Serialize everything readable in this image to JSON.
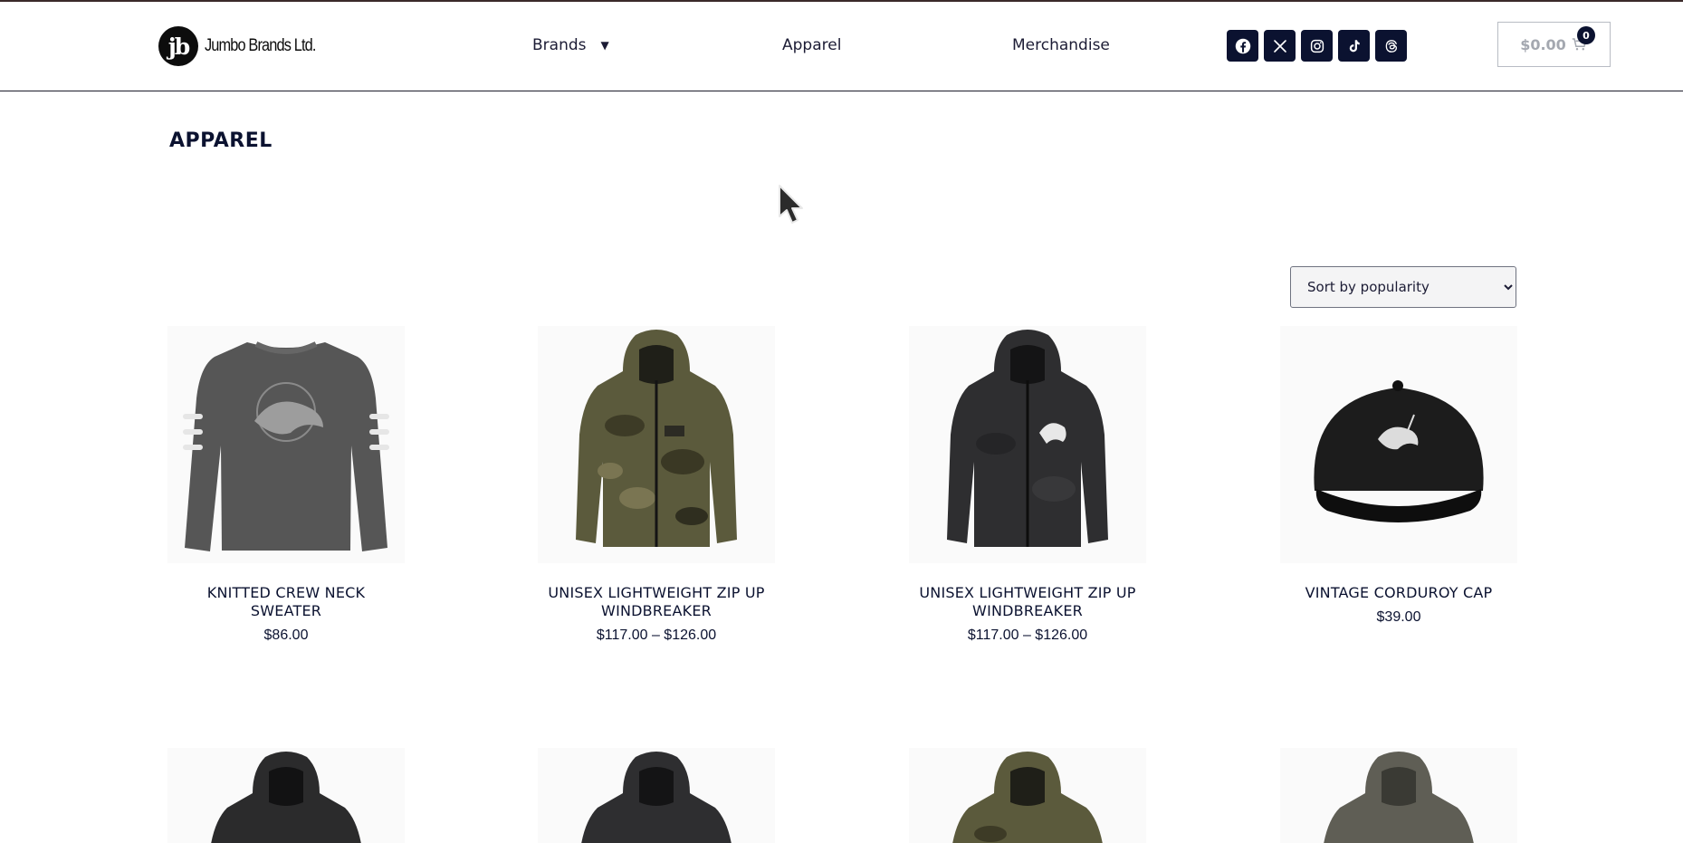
{
  "header": {
    "logo_mark": "jb",
    "logo_text": "Jumbo Brands Ltd.",
    "nav": {
      "brands": "Brands",
      "apparel": "Apparel",
      "merchandise": "Merchandise"
    },
    "social_icons": [
      "facebook-icon",
      "x-icon",
      "instagram-icon",
      "tiktok-icon",
      "threads-icon"
    ],
    "cart": {
      "total": "$0.00",
      "count": "0"
    }
  },
  "page": {
    "title": "APPAREL"
  },
  "sort": {
    "selected": "Sort by popularity",
    "options": [
      "Sort by popularity"
    ]
  },
  "products": [
    {
      "name": "KNITTED CREW NECK SWEATER",
      "price": "$86.00"
    },
    {
      "name": "UNISEX LIGHTWEIGHT ZIP UP WINDBREAKER",
      "price": "$117.00 – $126.00"
    },
    {
      "name": "UNISEX LIGHTWEIGHT ZIP UP WINDBREAKER",
      "price": "$117.00 – $126.00"
    },
    {
      "name": "VINTAGE CORDUROY CAP",
      "price": "$39.00"
    }
  ],
  "colors": {
    "navy": "#0b1230",
    "cart_text": "#a4a8b0"
  }
}
